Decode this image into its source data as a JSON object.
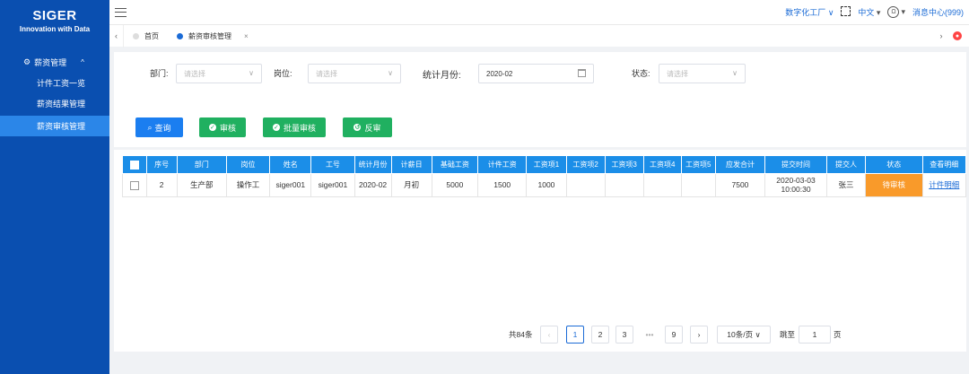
{
  "sidebar": {
    "logo_title": "SIGER",
    "logo_subtitle": "Innovation with Data",
    "group_label": "薪资管理",
    "items": [
      {
        "label": "计件工资一览"
      },
      {
        "label": "薪资结果管理"
      },
      {
        "label": "薪资审核管理"
      }
    ]
  },
  "topbar": {
    "factory": "数字化工厂",
    "language": "中文",
    "messages": "消息中心(999)"
  },
  "tabs": [
    {
      "label": "首页"
    },
    {
      "label": "薪资审核管理"
    }
  ],
  "filters": {
    "dept_label": "部门:",
    "dept_placeholder": "请选择",
    "post_label": "岗位:",
    "post_placeholder": "请选择",
    "month_label": "统计月份:",
    "month_value": "2020-02",
    "status_label": "状态:",
    "status_placeholder": "请选择"
  },
  "buttons": {
    "query": "查询",
    "audit": "审核",
    "batch_audit": "批量审核",
    "reverse_audit": "反审"
  },
  "table": {
    "columns": [
      "序号",
      "部门",
      "岗位",
      "姓名",
      "工号",
      "统计月份",
      "计薪日",
      "基础工资",
      "计件工资",
      "工资项1",
      "工资项2",
      "工资项3",
      "工资项4",
      "工资项5",
      "应发合计",
      "提交时间",
      "提交人",
      "状态",
      "查看明细"
    ],
    "rows": [
      {
        "no": "2",
        "dept": "生产部",
        "post": "操作工",
        "name": "siger001",
        "emp_no": "siger001",
        "month": "2020-02",
        "pay_day": "月初",
        "base_salary": "5000",
        "piece_salary": "1500",
        "item1": "1000",
        "item2": "",
        "item3": "",
        "item4": "",
        "item5": "",
        "total": "7500",
        "submit_date": "2020-03-03",
        "submit_time": "10:00:30",
        "submitter": "张三",
        "status": "待审核",
        "detail": "计件明细"
      }
    ]
  },
  "pagination": {
    "total": "共84条",
    "pages": [
      "1",
      "2",
      "3"
    ],
    "ellipsis": "•••",
    "last_page": "9",
    "page_size": "10条/页",
    "jump_label": "跳至",
    "jump_value": "1",
    "page_unit": "页"
  },
  "colors": {
    "sidebar": "#0a4fb0",
    "header": "#1b8ee8",
    "status_pending": "#f99a2a",
    "primary": "#1b7ef0",
    "success": "#20b060"
  }
}
